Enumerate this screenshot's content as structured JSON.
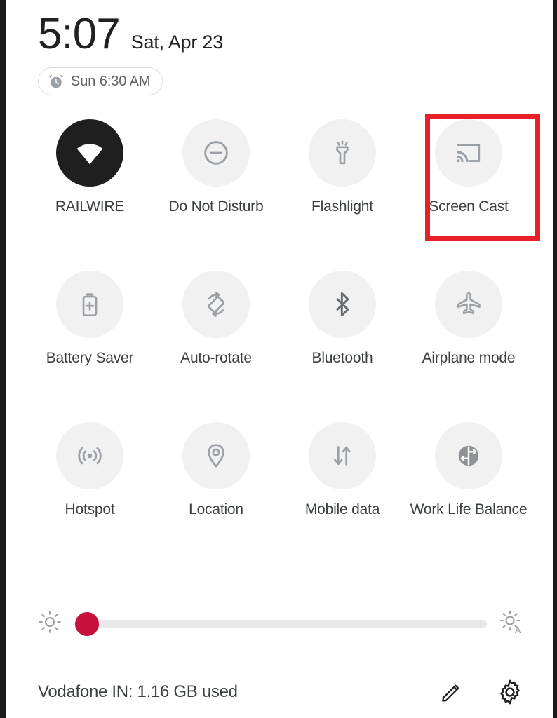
{
  "status": {
    "time": "5:07",
    "date": "Sat, Apr 23",
    "alarm": "Sun 6:30 AM",
    "alarm_icon": "alarm-clock-icon"
  },
  "tiles": [
    {
      "label": "RAILWIRE",
      "icon": "wifi-icon",
      "active": true,
      "highlighted": false
    },
    {
      "label": "Do Not Disturb",
      "icon": "do-not-disturb-icon",
      "active": false,
      "highlighted": false
    },
    {
      "label": "Flashlight",
      "icon": "flashlight-icon",
      "active": false,
      "highlighted": false
    },
    {
      "label": "Screen Cast",
      "icon": "screen-cast-icon",
      "active": false,
      "highlighted": true
    },
    {
      "label": "Battery Saver",
      "icon": "battery-saver-icon",
      "active": false,
      "highlighted": false
    },
    {
      "label": "Auto-rotate",
      "icon": "auto-rotate-icon",
      "active": false,
      "highlighted": false
    },
    {
      "label": "Bluetooth",
      "icon": "bluetooth-icon",
      "active": false,
      "highlighted": false
    },
    {
      "label": "Airplane mode",
      "icon": "airplane-icon",
      "active": false,
      "highlighted": false
    },
    {
      "label": "Hotspot",
      "icon": "hotspot-icon",
      "active": false,
      "highlighted": false
    },
    {
      "label": "Location",
      "icon": "location-pin-icon",
      "active": false,
      "highlighted": false
    },
    {
      "label": "Mobile data",
      "icon": "mobile-data-icon",
      "active": false,
      "highlighted": false
    },
    {
      "label": "Work Life Balance",
      "icon": "work-life-balance-icon",
      "active": false,
      "highlighted": false
    }
  ],
  "brightness": {
    "left_icon": "brightness-low-icon",
    "right_icon": "brightness-auto-icon",
    "value_percent": 3
  },
  "footer": {
    "carrier_usage": "Vodafone IN: 1.16 GB used",
    "edit_icon": "pencil-icon",
    "settings_icon": "gear-icon"
  },
  "colors": {
    "accent": "#c8103c",
    "highlight": "#e8202a",
    "tile_bg": "#f1f1f1",
    "tile_active_bg": "#1f1f1f"
  }
}
